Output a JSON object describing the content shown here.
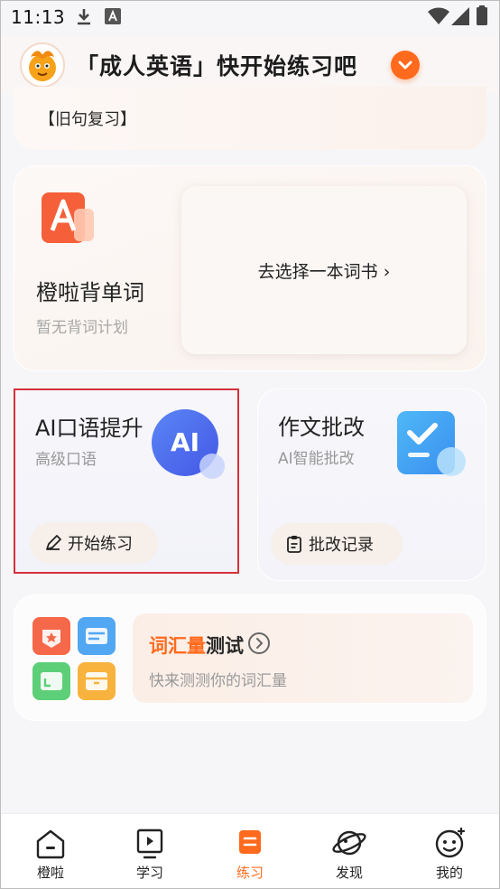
{
  "status_bar": {
    "time": "11:13"
  },
  "header": {
    "title": "「成人英语」快开始练习吧"
  },
  "review": {
    "label": "【旧句复习】"
  },
  "words": {
    "title": "橙啦背单词",
    "subtitle": "暂无背词计划",
    "select_book": "去选择一本词书 ›"
  },
  "ai_speaking": {
    "title": "AI口语提升",
    "subtitle": "高级口语",
    "icon_text": "AI",
    "button": "开始练习"
  },
  "essay": {
    "title": "作文批改",
    "subtitle": "AI智能批改",
    "button": "批改记录"
  },
  "vocab": {
    "title_highlight": "词汇量",
    "title_rest": "测试",
    "subtitle": "快来测测你的词汇量"
  },
  "tabs": [
    {
      "label": "橙啦",
      "icon": "home-icon"
    },
    {
      "label": "学习",
      "icon": "play-icon"
    },
    {
      "label": "练习",
      "icon": "practice-icon",
      "active": true
    },
    {
      "label": "发现",
      "icon": "planet-icon"
    },
    {
      "label": "我的",
      "icon": "smile-icon"
    }
  ],
  "colors": {
    "accent": "#ff6a1d",
    "ai_blue": "#4f6ef2",
    "essay_blue": "#3fa4f0",
    "highlight_box": "#d6313b"
  }
}
